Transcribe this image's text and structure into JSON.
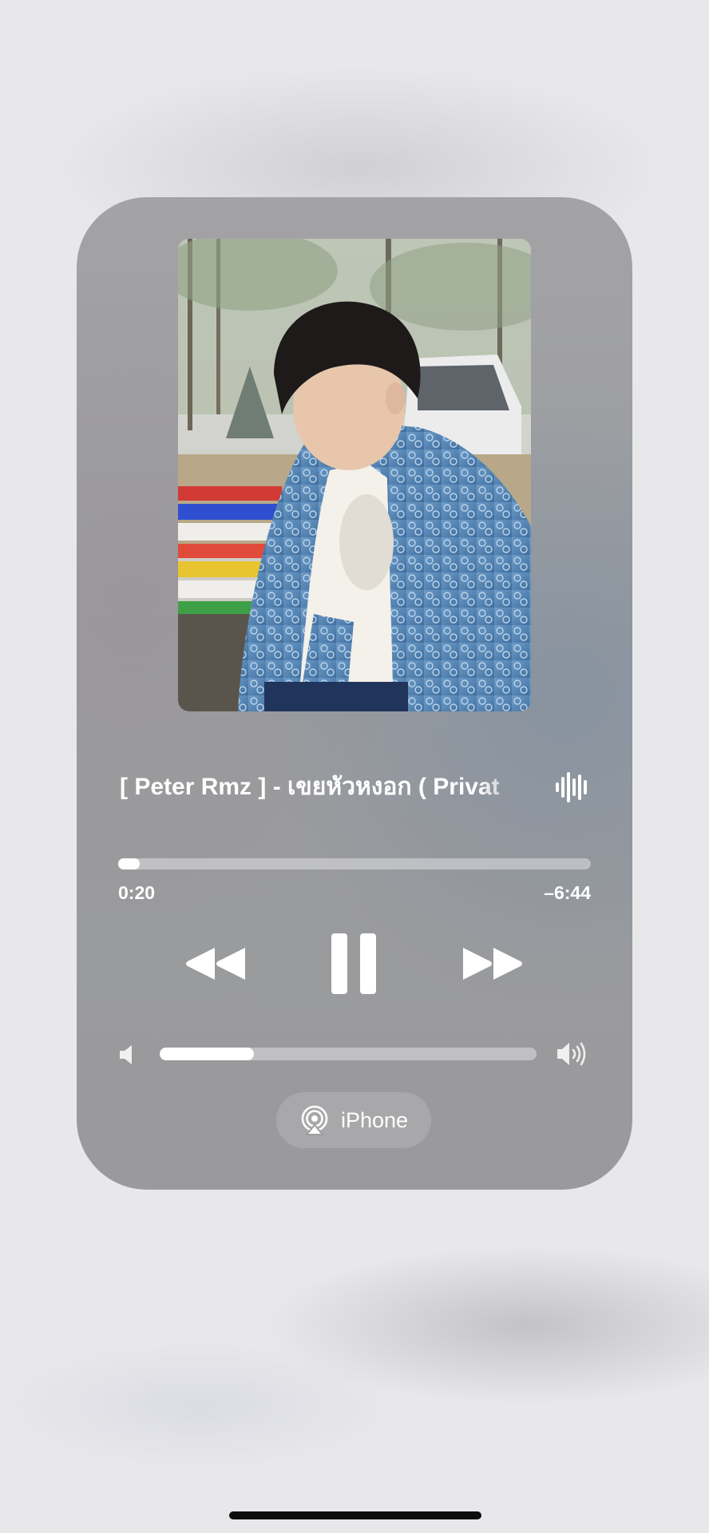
{
  "now_playing": {
    "title": "[ Peter Rmz ] - เขยหัวหงอก ( Privat",
    "elapsed": "0:20",
    "remaining": "–6:44",
    "progress_fraction": 0.045,
    "volume_fraction": 0.25
  },
  "controls": {
    "rewind_icon": "backward-icon",
    "pause_icon": "pause-icon",
    "forward_icon": "forward-icon"
  },
  "output": {
    "device_label": "iPhone",
    "icon": "airplay-icon"
  },
  "colors": {
    "card": "#9b9c9f",
    "page_background": "#e8e7ea",
    "foreground": "#ffffff"
  }
}
